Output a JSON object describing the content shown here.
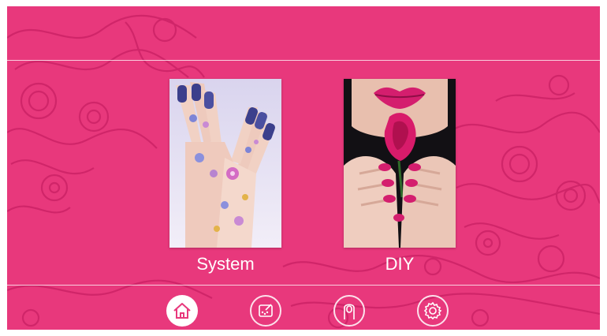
{
  "theme": {
    "background": "#e8387c",
    "pattern_color": "#c91f63",
    "text_color": "#ffffff"
  },
  "menu": {
    "cards": [
      {
        "label": "System",
        "image": "hands-with-floral-nail-art"
      },
      {
        "label": "DIY",
        "image": "lips-and-pink-rose-with-pink-nails"
      }
    ]
  },
  "nav": {
    "items": [
      {
        "icon": "home-icon",
        "active": true
      },
      {
        "icon": "paint-palette-icon",
        "active": false
      },
      {
        "icon": "finger-nail-icon",
        "active": false
      },
      {
        "icon": "gear-icon",
        "active": false
      }
    ]
  }
}
